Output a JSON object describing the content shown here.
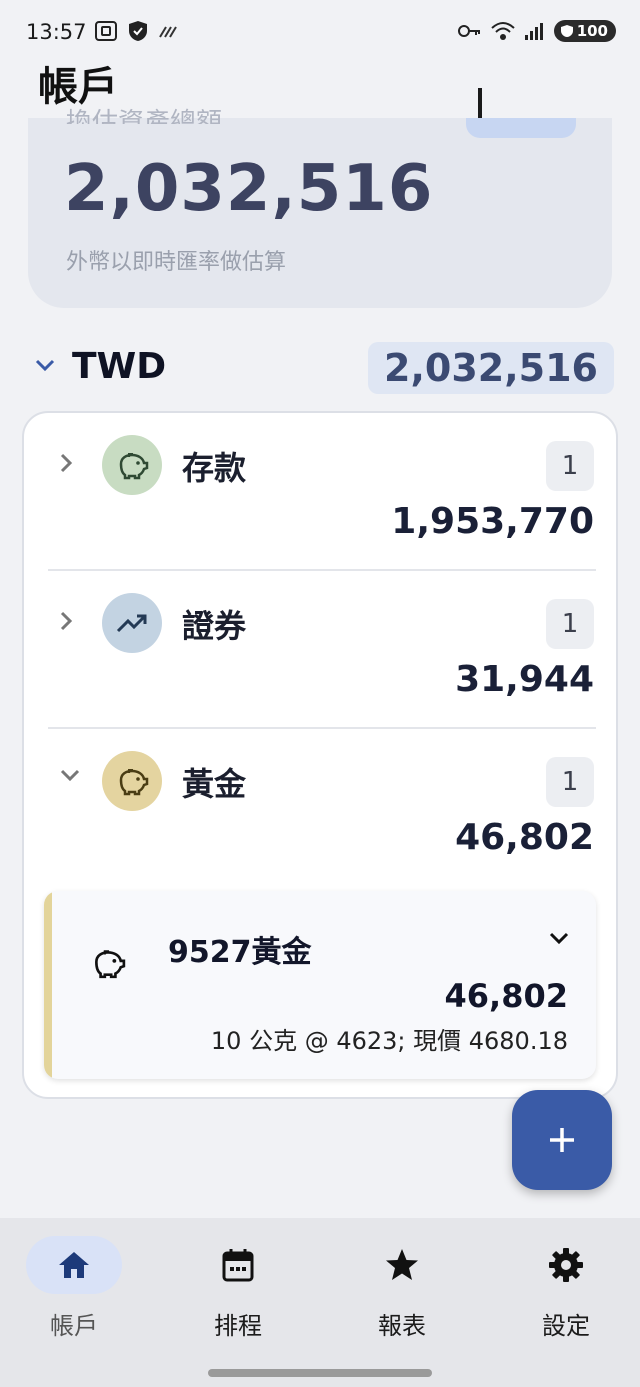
{
  "status_bar": {
    "time": "13:57",
    "battery": "100",
    "icons": [
      "screenshot-icon",
      "shield-icon",
      "signal-slash-icon",
      "key-icon",
      "wifi-icon",
      "cell-signal-icon",
      "battery-icon"
    ]
  },
  "app_bar": {
    "title": "帳戶",
    "actions": [
      "add-account-icon",
      "download-icon"
    ]
  },
  "summary": {
    "label": "換估資產總額",
    "total": "2,032,516",
    "note": "外幣以即時匯率做估算"
  },
  "currency_group": {
    "code": "TWD",
    "total": "2,032,516",
    "expanded": true
  },
  "categories": [
    {
      "name": "存款",
      "count": "1",
      "amount": "1,953,770",
      "icon": "piggy-bank-icon",
      "color": "#c8dcc2",
      "expanded": false
    },
    {
      "name": "證券",
      "count": "1",
      "amount": "31,944",
      "icon": "trending-up-icon",
      "color": "#c3d3e2",
      "expanded": false
    },
    {
      "name": "黃金",
      "count": "1",
      "amount": "46,802",
      "icon": "piggy-bank-icon",
      "color": "#e4d4a0",
      "expanded": true
    }
  ],
  "accounts": [
    {
      "name": "9527黃金",
      "amount": "46,802",
      "detail": "10 公克 @ 4623; 現價 4680.18",
      "icon": "piggy-bank-icon",
      "accent": "#e3d49a"
    }
  ],
  "fab": {
    "icon": "plus-icon"
  },
  "bottom_nav": [
    {
      "label": "帳戶",
      "icon": "home-icon",
      "active": true
    },
    {
      "label": "排程",
      "icon": "calendar-icon",
      "active": false
    },
    {
      "label": "報表",
      "icon": "star-icon",
      "active": false
    },
    {
      "label": "設定",
      "icon": "gear-icon",
      "active": false
    }
  ],
  "colors": {
    "background": "#f1f2f5",
    "summary_card": "#e4e7ee",
    "currency_total_bg": "#dfe6f3",
    "primary": "#3a5ba7",
    "nav_active": "#d9e2f7"
  }
}
